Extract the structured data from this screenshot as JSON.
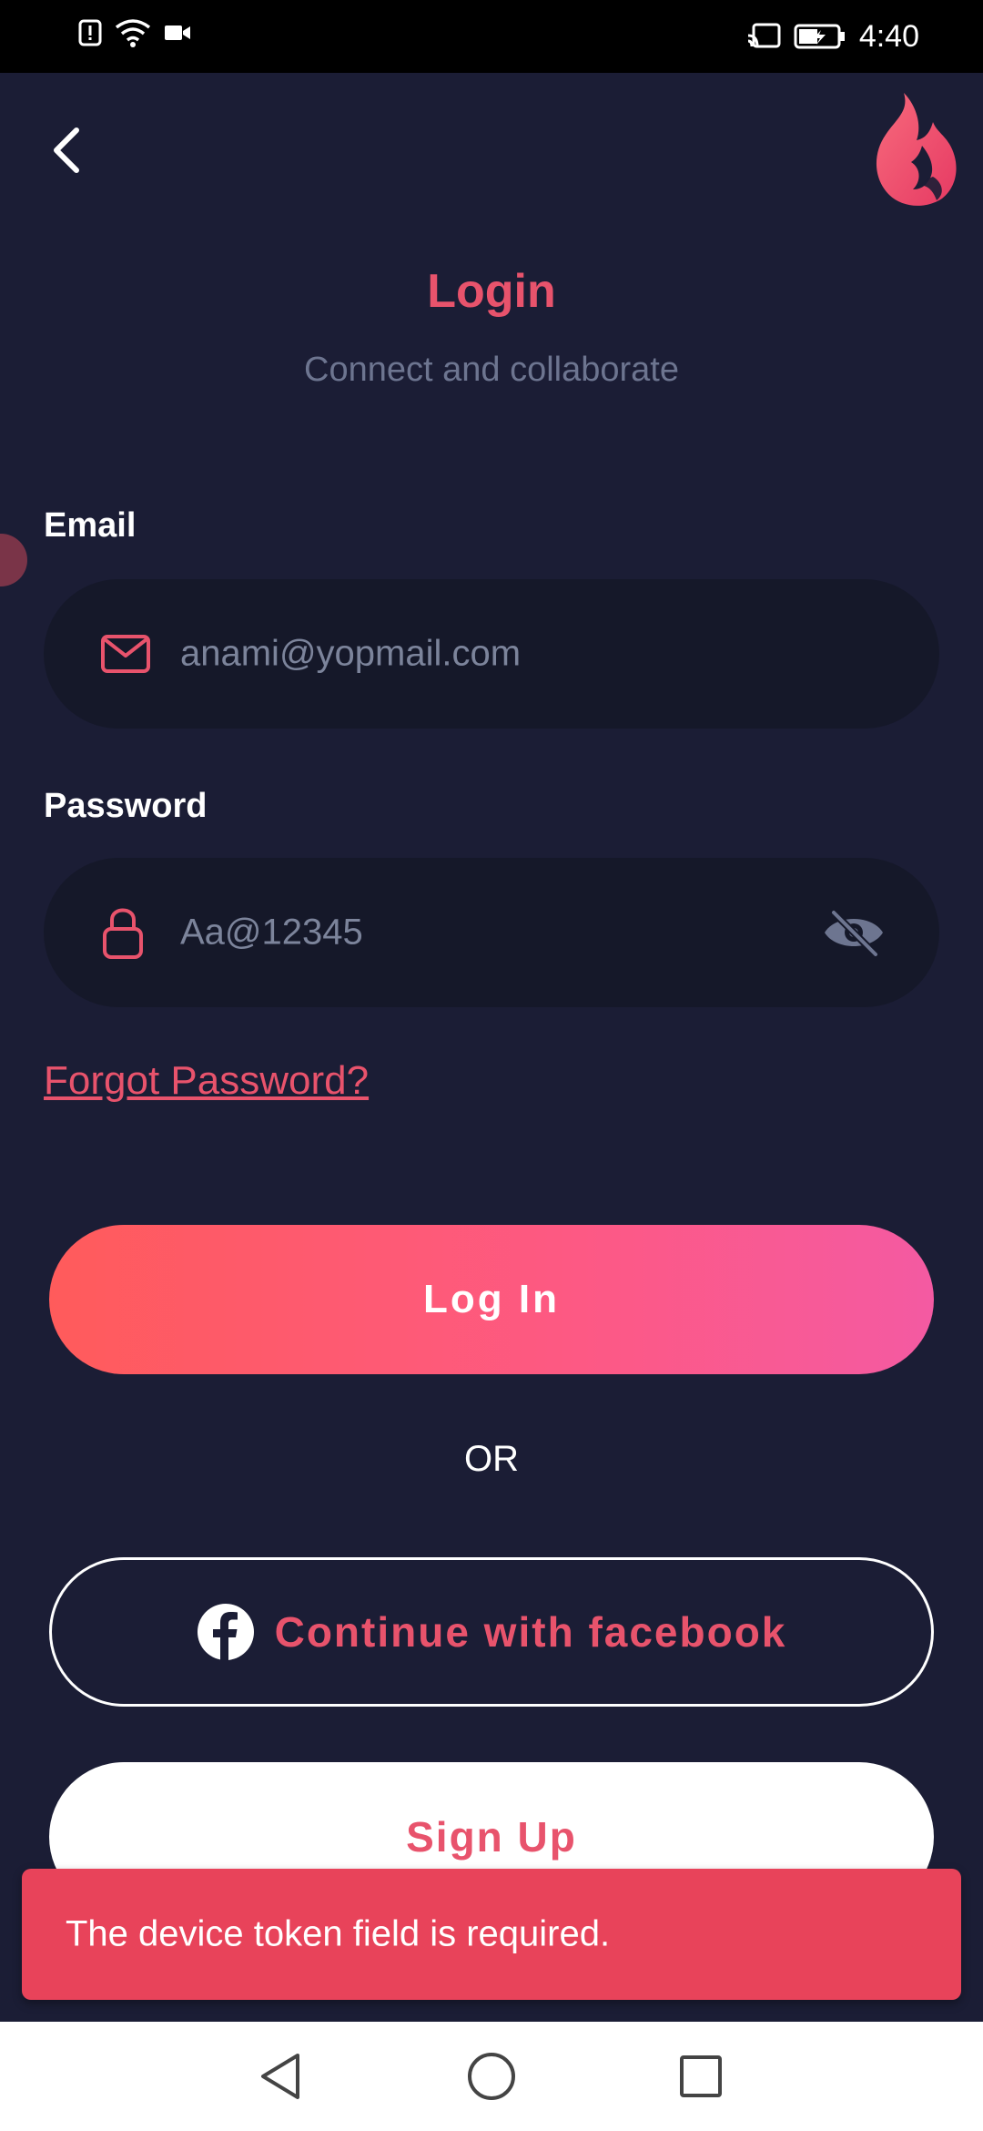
{
  "status_bar": {
    "time": "4:40",
    "left_icons": [
      "alert-icon",
      "wifi-icon",
      "video-icon"
    ],
    "right_icons": [
      "cast-icon",
      "battery-charging-icon"
    ]
  },
  "header": {
    "title": "Login",
    "subtitle": "Connect and collaborate"
  },
  "form": {
    "email_label": "Email",
    "email_value": "anami@yopmail.com",
    "password_label": "Password",
    "password_value": "Aa@12345",
    "forgot_password": "Forgot Password?"
  },
  "actions": {
    "login_label": "Log In",
    "or_text": "OR",
    "facebook_label": "Continue with facebook",
    "signup_label": "Sign Up"
  },
  "toast": {
    "message": "The device token field is required."
  },
  "colors": {
    "background": "#1b1d35",
    "accent": "#e8536c",
    "toast": "#e8435a",
    "input_bg": "#151829"
  }
}
